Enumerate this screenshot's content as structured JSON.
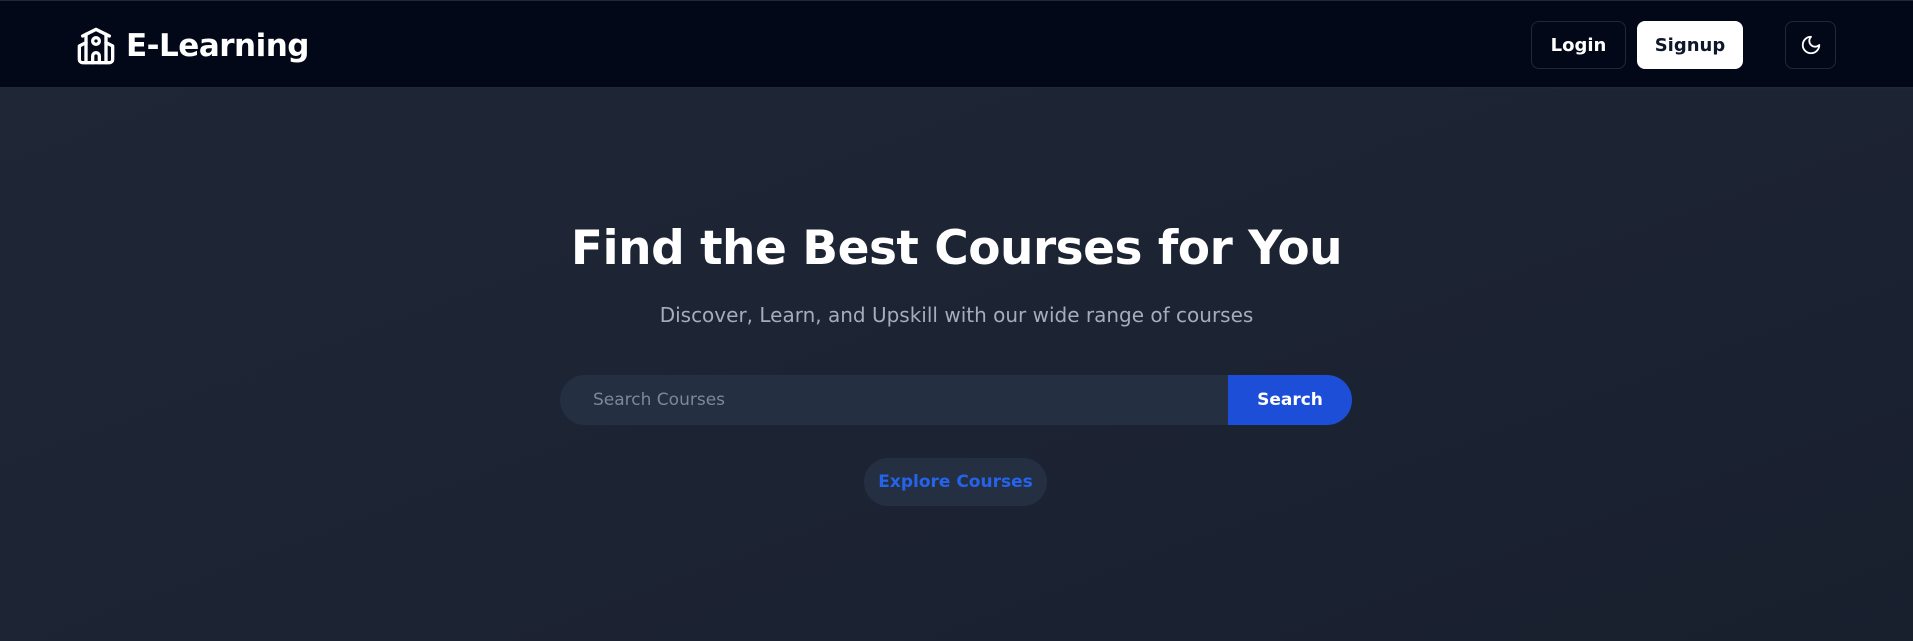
{
  "navbar": {
    "brand_name": "E-Learning",
    "brand_icon": "school-icon",
    "login_label": "Login",
    "signup_label": "Signup",
    "theme_toggle_icon": "moon-icon"
  },
  "hero": {
    "title": "Find the Best Courses for You",
    "subtitle": "Discover, Learn, and Upskill with our wide range of courses",
    "search": {
      "placeholder": "Search Courses",
      "value": "",
      "button_label": "Search"
    },
    "explore_label": "Explore Courses"
  },
  "colors": {
    "navbar_bg": "#020817",
    "hero_bg": "#1e2535",
    "accent": "#1d4ed8",
    "link_blue": "#2563eb",
    "text_primary": "#ffffff",
    "text_muted": "#a3adbd"
  }
}
